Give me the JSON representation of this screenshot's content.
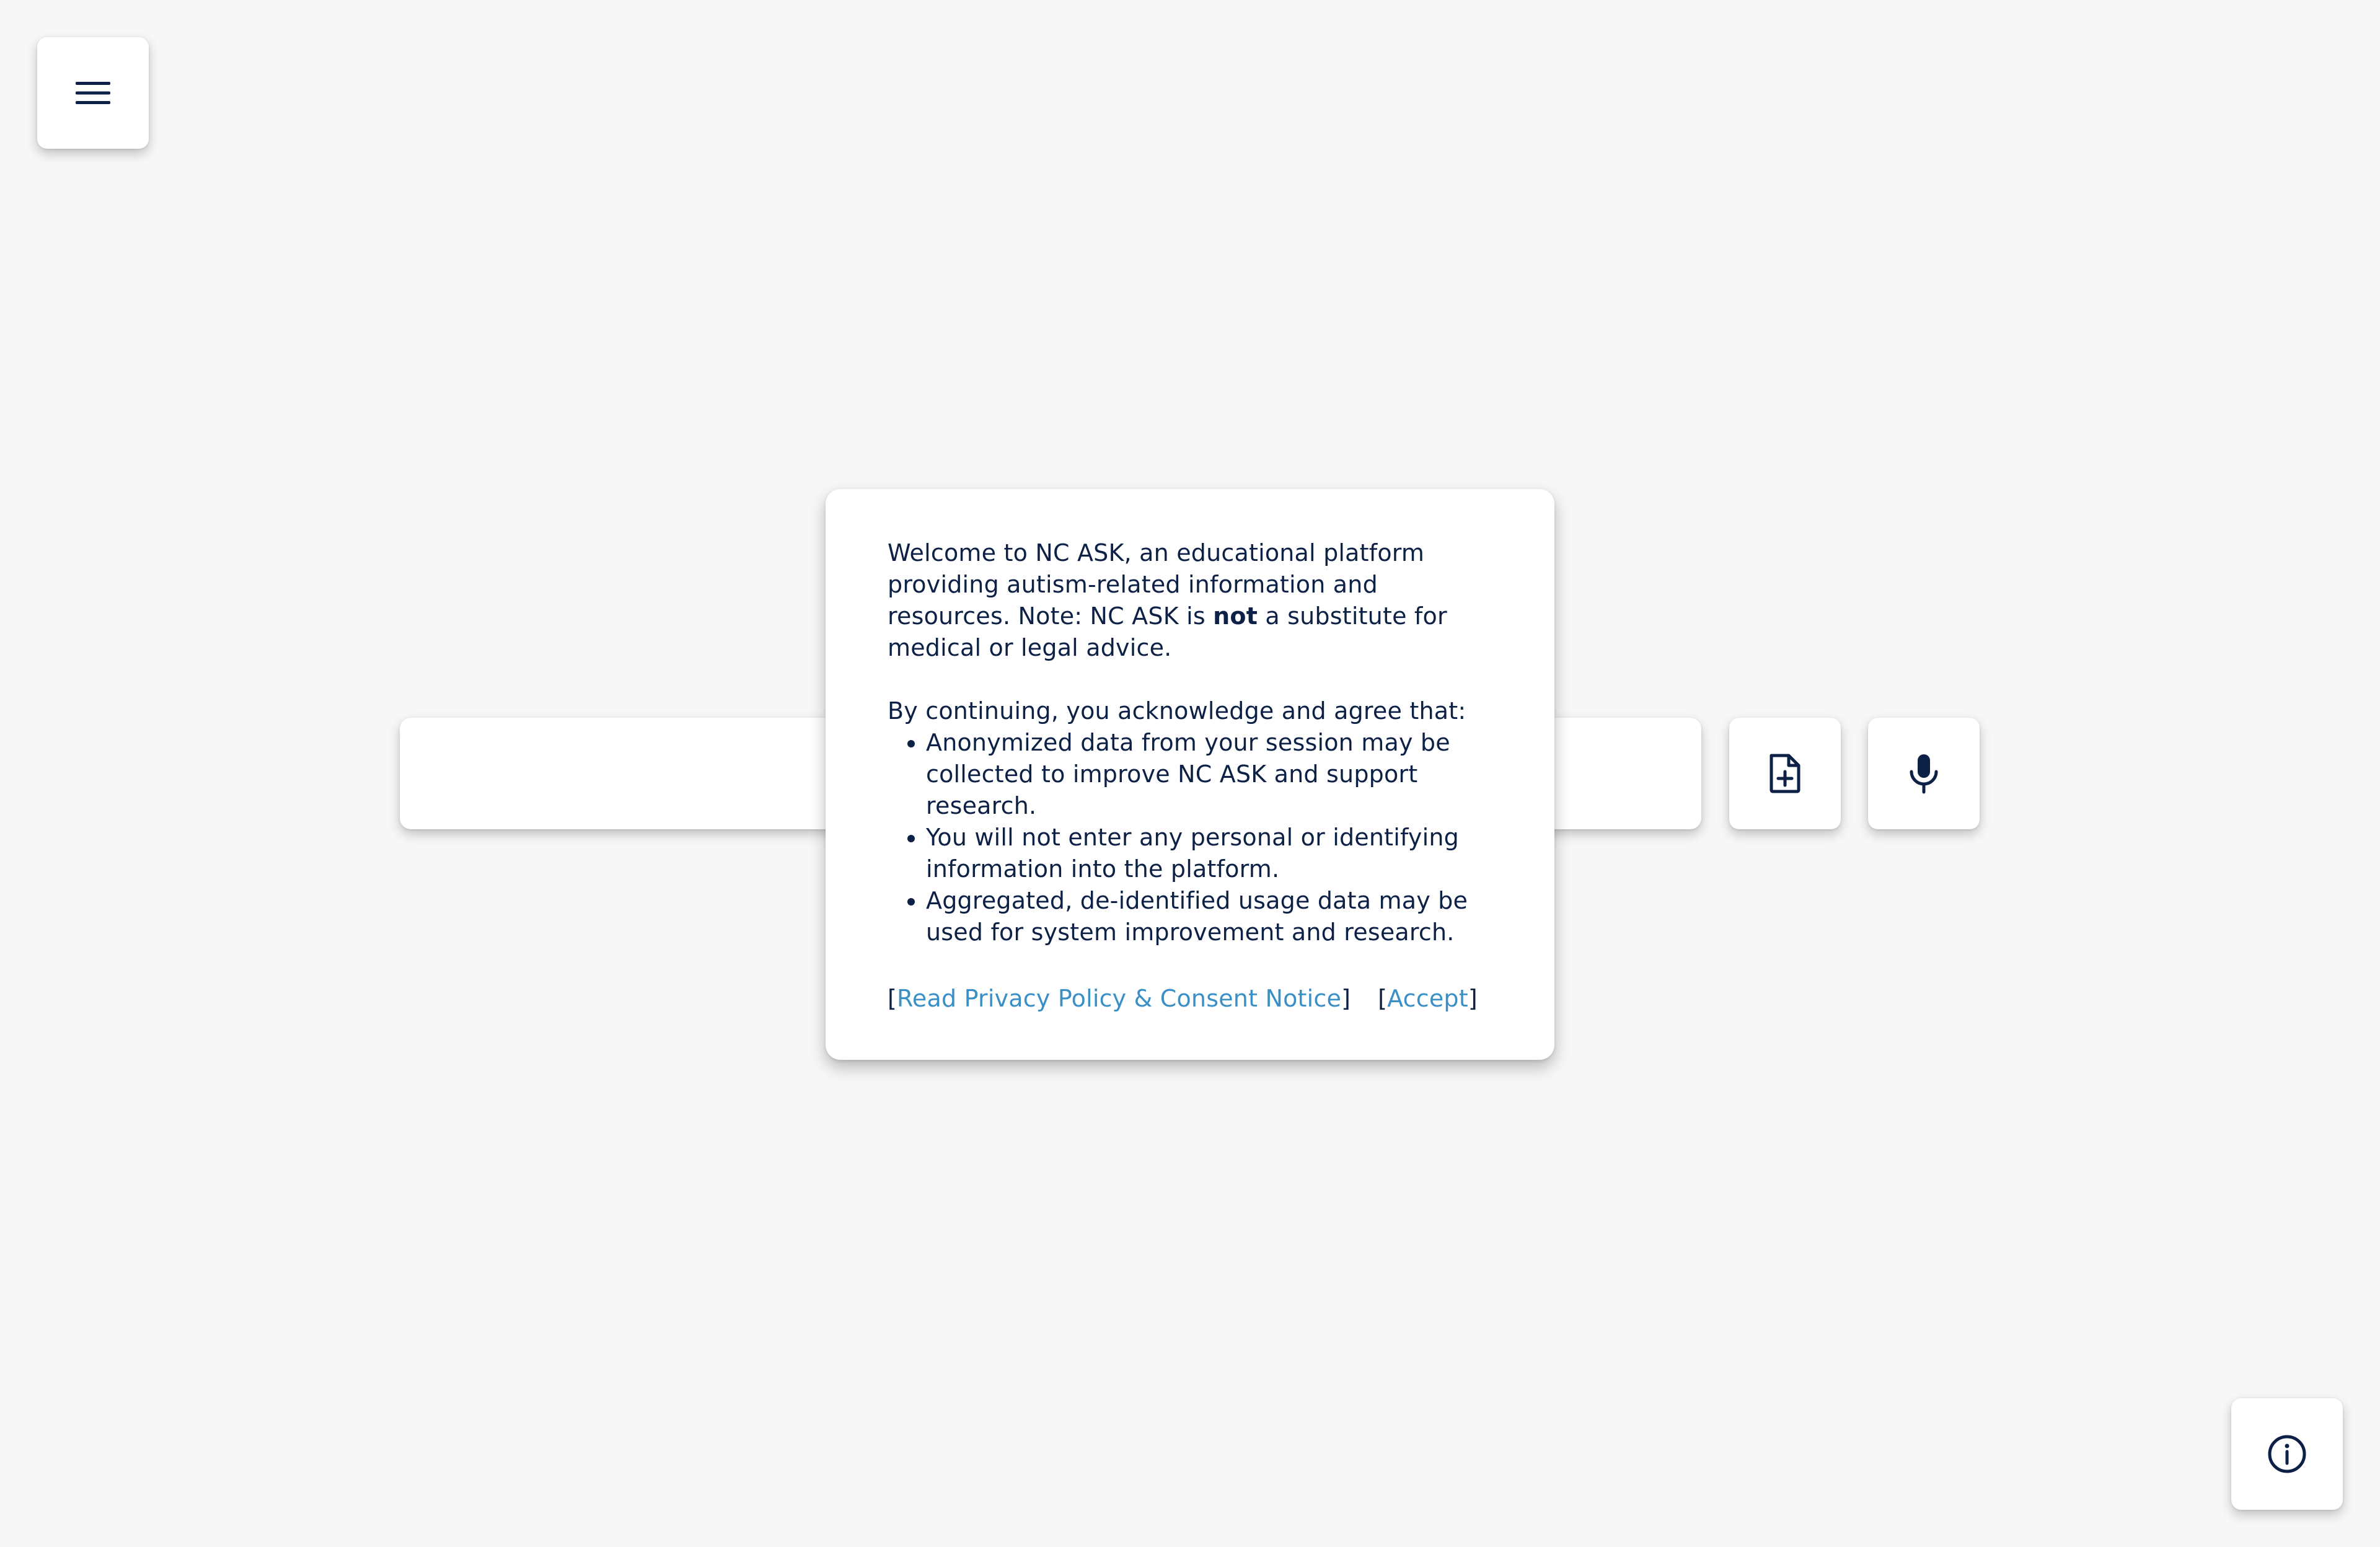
{
  "menu": {
    "icon": "hamburger-menu-icon"
  },
  "search": {
    "value": "",
    "placeholder": ""
  },
  "upload": {
    "icon": "file-plus-icon"
  },
  "mic": {
    "icon": "microphone-icon"
  },
  "info": {
    "icon": "info-circle-icon"
  },
  "consent": {
    "intro_before_bold": "Welcome to NC ASK, an educational platform providing autism-related information and resources. Note: NC ASK is ",
    "intro_bold": "not",
    "intro_after_bold": " a substitute for medical or legal advice.",
    "agree_heading": "By continuing, you acknowledge and agree that:",
    "bullets": [
      "Anonymized data from your session may be collected to improve NC ASK and support research.",
      "You will not enter any personal or identifying information into the platform.",
      "Aggregated, de-identified usage data may be used for system improvement and research."
    ],
    "bracket_open": "[",
    "bracket_close": "]",
    "privacy_link": "Read Privacy Policy & Consent Notice",
    "accept_link": "Accept"
  },
  "colors": {
    "background": "#f7f7f7",
    "text": "#0d2146",
    "link": "#3a8fc7",
    "card": "#ffffff"
  }
}
